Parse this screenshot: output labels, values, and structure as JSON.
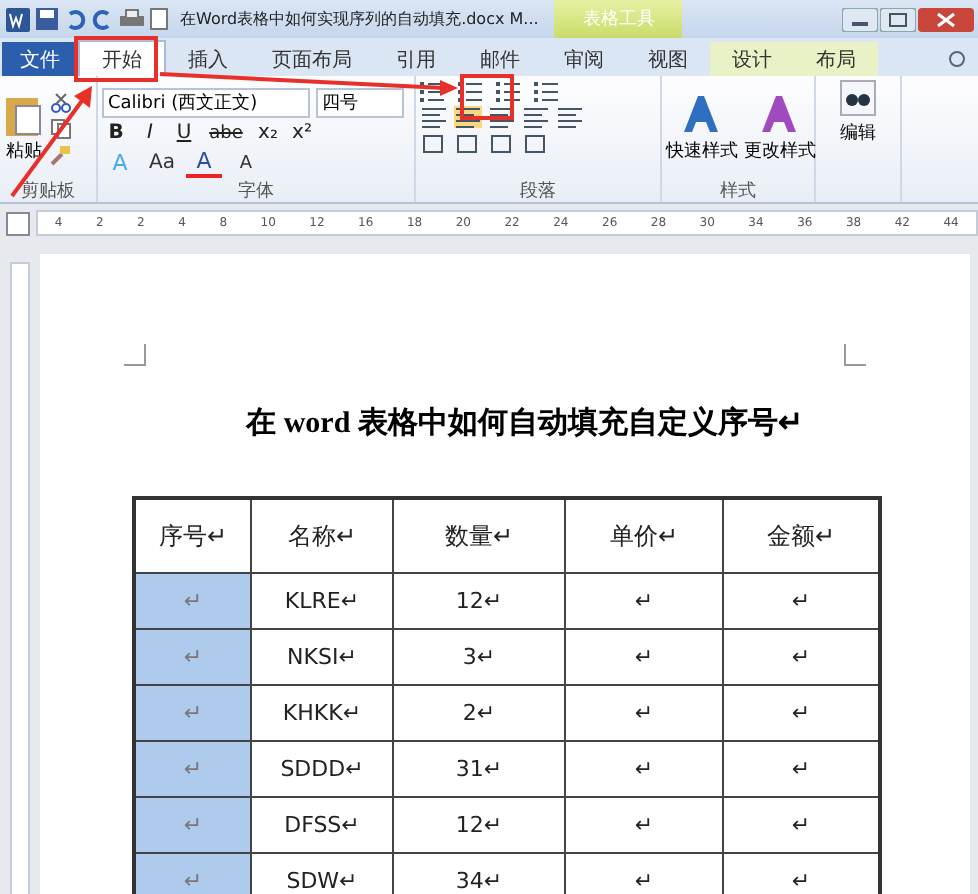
{
  "title_bar": {
    "title": "在Word表格中如何实现序列的自动填充.docx M...",
    "context_group": "表格工具"
  },
  "tabs": [
    {
      "label": "文件",
      "kind": "file",
      "selected": false
    },
    {
      "label": "开始",
      "kind": "normal",
      "selected": true
    },
    {
      "label": "插入",
      "kind": "normal",
      "selected": false
    },
    {
      "label": "页面布局",
      "kind": "normal",
      "selected": false
    },
    {
      "label": "引用",
      "kind": "normal",
      "selected": false
    },
    {
      "label": "邮件",
      "kind": "normal",
      "selected": false
    },
    {
      "label": "审阅",
      "kind": "normal",
      "selected": false
    },
    {
      "label": "视图",
      "kind": "normal",
      "selected": false
    },
    {
      "label": "设计",
      "kind": "context",
      "selected": false
    },
    {
      "label": "布局",
      "kind": "context",
      "selected": false
    }
  ],
  "ribbon": {
    "clipboard": {
      "paste": "粘贴",
      "label": "剪贴板"
    },
    "font": {
      "font_name": "Calibri (西文正文)",
      "font_size": "四号",
      "label": "字体",
      "format_buttons": [
        "B",
        "I",
        "U",
        "abe",
        "x₂",
        "x²"
      ],
      "color_buttons": [
        "A",
        "Aa",
        "A",
        "A"
      ]
    },
    "paragraph": {
      "label": "段落"
    },
    "styles": {
      "buttons": [
        "快速样式",
        "更改样式"
      ],
      "label": "样式"
    },
    "editing": {
      "button": "编辑"
    }
  },
  "ruler": [
    "4",
    "2",
    "2",
    "4",
    "8",
    "10",
    "12",
    "16",
    "18",
    "20",
    "22",
    "24",
    "26",
    "28",
    "30",
    "34",
    "36",
    "38",
    "42",
    "44"
  ],
  "document": {
    "heading": "在 word 表格中如何自动填充自定义序号↵",
    "table": {
      "columns": [
        "序号↵",
        "名称↵",
        "数量↵",
        "单价↵",
        "金额↵"
      ],
      "rows": [
        {
          "selected": true,
          "cells": [
            "↵",
            "KLRE↵",
            "12↵",
            "↵",
            "↵"
          ]
        },
        {
          "selected": true,
          "cells": [
            "↵",
            "NKSI↵",
            "3↵",
            "↵",
            "↵"
          ]
        },
        {
          "selected": true,
          "cells": [
            "↵",
            "KHKK↵",
            "2↵",
            "↵",
            "↵"
          ]
        },
        {
          "selected": true,
          "cells": [
            "↵",
            "SDDD↵",
            "31↵",
            "↵",
            "↵"
          ]
        },
        {
          "selected": true,
          "cells": [
            "↵",
            "DFSS↵",
            "12↵",
            "↵",
            "↵"
          ]
        },
        {
          "selected": true,
          "cells": [
            "↵",
            "SDW↵",
            "34↵",
            "↵",
            "↵"
          ]
        }
      ]
    }
  }
}
